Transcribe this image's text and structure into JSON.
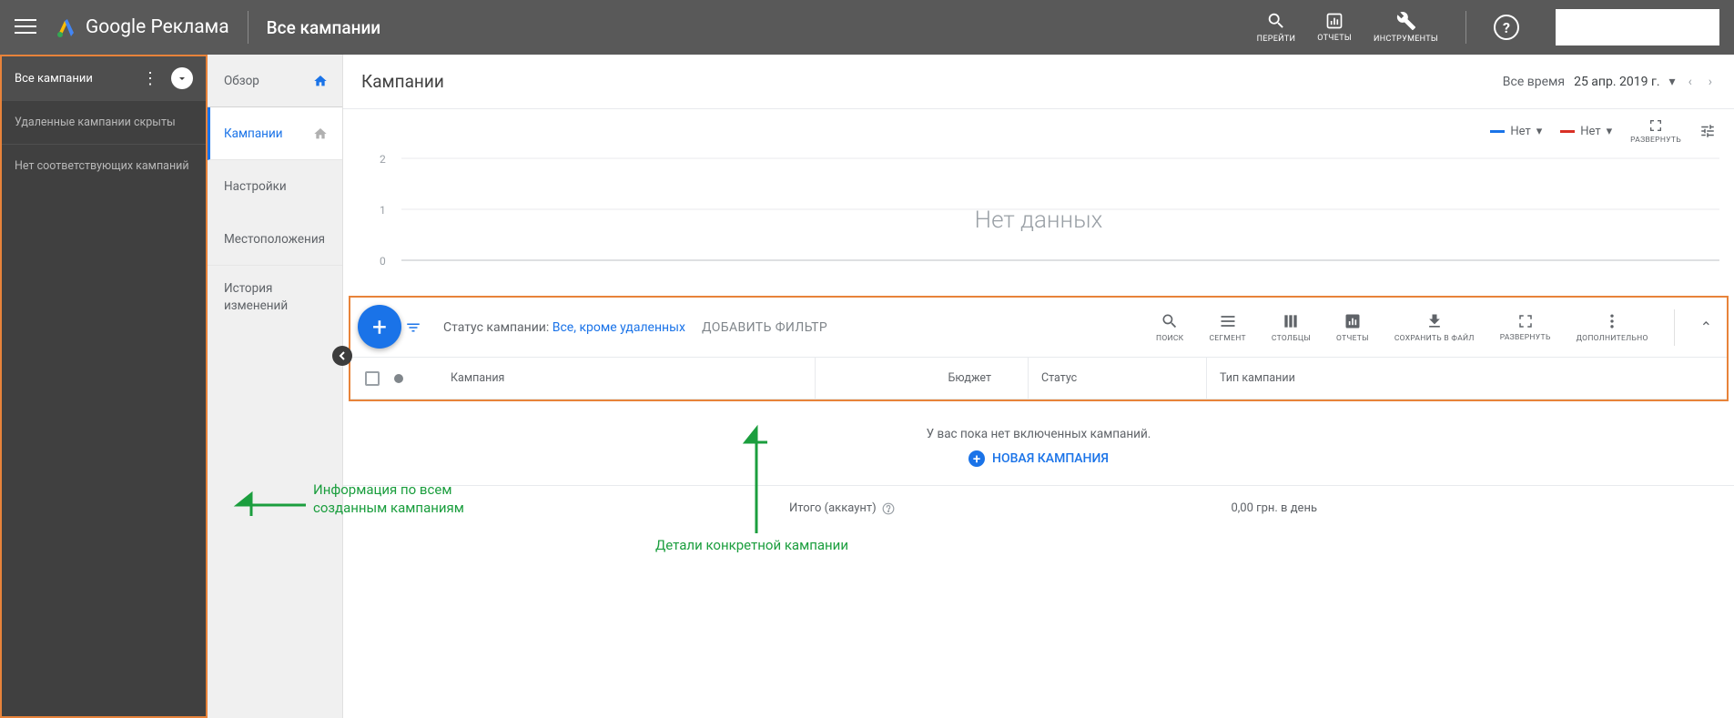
{
  "header": {
    "brand": "Google Реклама",
    "page_title": "Все кампании",
    "tools": {
      "go": "ПЕРЕЙТИ",
      "reports": "ОТЧЕТЫ",
      "tools_label": "ИНСТРУМЕНТЫ"
    }
  },
  "left_panel": {
    "title": "Все кампании",
    "hidden_deleted": "Удаленные кампании скрыты",
    "no_matching": "Нет соответствующих кампаний"
  },
  "nav": {
    "overview": "Обзор",
    "campaigns": "Кампании",
    "settings": "Настройки",
    "locations": "Местоположения",
    "history": "История изменений"
  },
  "main": {
    "title": "Кампании",
    "date_range_label": "Все время",
    "date_value": "25 апр. 2019 г."
  },
  "chart": {
    "metric1": "Нет",
    "metric2": "Нет",
    "expand": "РАЗВЕРНУТЬ",
    "no_data": "Нет данных",
    "ticks": {
      "a": "2",
      "b": "1",
      "c": "0"
    }
  },
  "toolbar": {
    "filter_prefix": "Статус кампании: ",
    "filter_value": "Все, кроме удаленных",
    "add_filter": "ДОБАВИТЬ ФИЛЬТР",
    "search": "ПОИСК",
    "segment": "СЕГМЕНТ",
    "columns": "СТОЛБЦЫ",
    "reports": "ОТЧЕТЫ",
    "save_file": "СОХРАНИТЬ В ФАЙЛ",
    "expand": "РАЗВЕРНУТЬ",
    "more": "ДОПОЛНИТЕЛЬНО"
  },
  "table": {
    "col_campaign": "Кампания",
    "col_budget": "Бюджет",
    "col_status": "Статус",
    "col_type": "Тип кампании",
    "empty_message": "У вас пока нет включенных кампаний.",
    "new_campaign": "НОВАЯ КАМПАНИЯ",
    "summary_label": "Итого (аккаунт)",
    "summary_budget": "0,00 грн. в день"
  },
  "annotations": {
    "left": "Информация по всем созданным кампаниям",
    "center": "Детали конкретной кампании"
  }
}
